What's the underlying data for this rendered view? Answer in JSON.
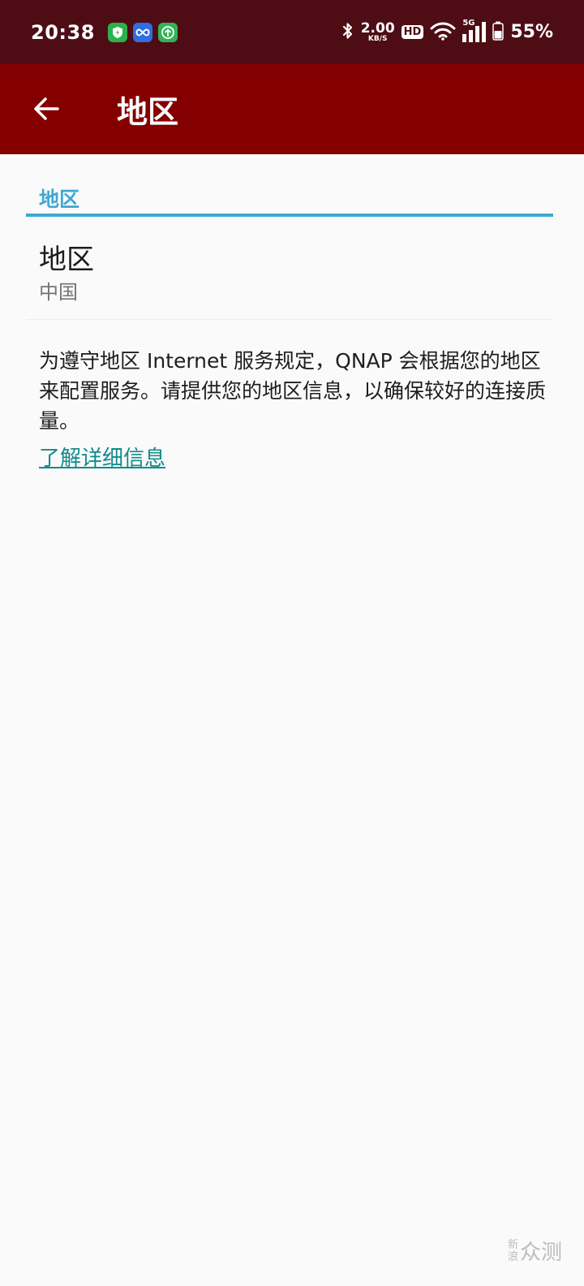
{
  "status_bar": {
    "time": "20:38",
    "speed_value": "2.00",
    "speed_unit": "KB/S",
    "hd": "HD",
    "network": "5G",
    "battery": "55%",
    "colors": {
      "background": "#4e0d14"
    },
    "icons": [
      "shield-app-icon",
      "infinity-app-icon",
      "upload-app-icon",
      "bluetooth-icon",
      "wifi-icon",
      "signal-icon",
      "battery-icon"
    ]
  },
  "app_bar": {
    "title": "地区",
    "back_icon": "arrow-left-icon",
    "color": "#840000"
  },
  "section": {
    "header": "地区",
    "accent_color": "#3ea8d4"
  },
  "preference": {
    "title": "地区",
    "summary": "中国"
  },
  "description": "为遵守地区 Internet 服务规定，QNAP 会根据您的地区来配置服务。请提供您的地区信息，以确保较好的连接质量。",
  "learn_more": "了解详细信息",
  "watermark": {
    "small_top": "新",
    "small_bottom": "浪",
    "big": "众测"
  }
}
